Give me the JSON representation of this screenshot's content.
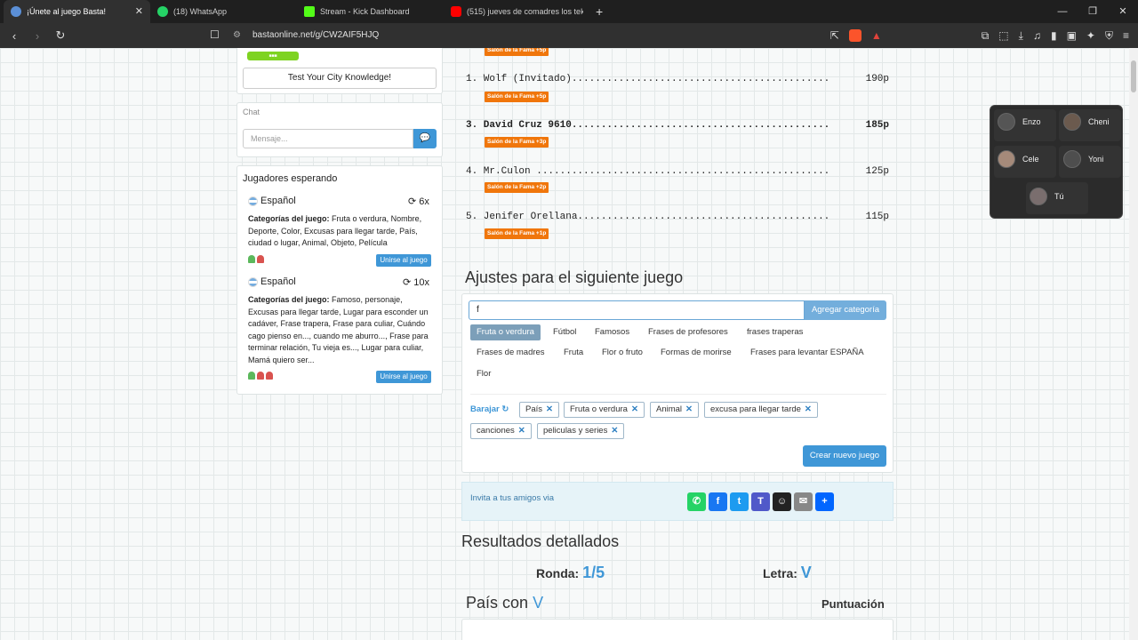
{
  "browser": {
    "tabs": [
      {
        "title": "¡Únete al juego Basta!",
        "active": true,
        "color": "#5b8fd6"
      },
      {
        "title": "(18) WhatsApp",
        "active": false,
        "color": "#25d366"
      },
      {
        "title": "Stream - Kick Dashboard",
        "active": false,
        "color": "#53fc18"
      },
      {
        "title": "(515) jueves de comadres los tekis -",
        "active": false,
        "color": "#ff0000"
      }
    ],
    "url": "bastaonline.net/g/CW2AIF5HJQ"
  },
  "sidebar": {
    "city_button": "Test Your City Knowledge!",
    "chat_label": "Chat",
    "chat_placeholder": "Mensaje...",
    "waiting_title": "Jugadores esperando",
    "games": [
      {
        "language": "Español",
        "count": "6x",
        "cats_label": "Categorías del juego:",
        "cats": "Fruta o verdura, Nombre, Deporte, Color, Excusas para llegar tarde, País, ciudad o lugar, Animal, Objeto, Película",
        "join": "Unirse al juego"
      },
      {
        "language": "Español",
        "count": "10x",
        "cats_label": "Categorías del juego:",
        "cats": "Famoso, personaje, Excusas para llegar tarde, Lugar para esconder un cadáver, Frase trapera, Frase para culiar, Cuándo cago pienso en..., cuando me aburro..., Frase para terminar relación, Tu vieja es..., Lugar para culiar, Mamá quiero ser...",
        "join": "Unirse al juego"
      }
    ]
  },
  "ranking": [
    {
      "line": "1. Wolf (Invitado)............................................",
      "points": "190p",
      "fame": "Salón de la Fama +5p",
      "bold": false
    },
    {
      "line": "3. David Cruz 9610............................................",
      "points": "185p",
      "fame": "Salón de la Fama +3p",
      "bold": true
    },
    {
      "line": "4. Mr.Culon ..................................................",
      "points": "125p",
      "fame": "Salón de la Fama +2p",
      "bold": false
    },
    {
      "line": "5. Jenifer Orellana...........................................",
      "points": "115p",
      "fame": "Salón de la Fama +1p",
      "bold": false
    }
  ],
  "top_fame": "Salón de la Fama +5p",
  "settings": {
    "title": "Ajustes para el siguiente juego",
    "input_value": "f",
    "add_button": "Agregar categoría",
    "suggestions": [
      "Fruta o verdura",
      "Fútbol",
      "Famosos",
      "Frases de profesores",
      "frases traperas",
      "Frases de madres",
      "Fruta",
      "Flor o fruto",
      "Formas de morirse",
      "Frases para levantar ESPAÑA",
      "Flor"
    ],
    "shuffle": "Barajar",
    "selected": [
      "País",
      "Fruta o verdura",
      "Animal",
      "excusa para llegar tarde",
      "canciones",
      "peliculas y series"
    ],
    "new_game": "Crear nuevo juego"
  },
  "invite": {
    "text": "Invita a tus amigos via",
    "icons": [
      "whatsapp-icon",
      "facebook-icon",
      "twitter-icon",
      "teams-icon",
      "snapchat-icon",
      "email-icon",
      "share-icon"
    ]
  },
  "results": {
    "title": "Resultados detallados",
    "round_label": "Ronda:",
    "round_value": "1/5",
    "letter_label": "Letra:",
    "letter_value": "V",
    "category_prefix": "País con",
    "category_letter": "V",
    "score_header": "Puntuación"
  },
  "voice": {
    "users": [
      "Enzo",
      "Cheni",
      "Cele",
      "Yoni",
      "Tú"
    ]
  }
}
